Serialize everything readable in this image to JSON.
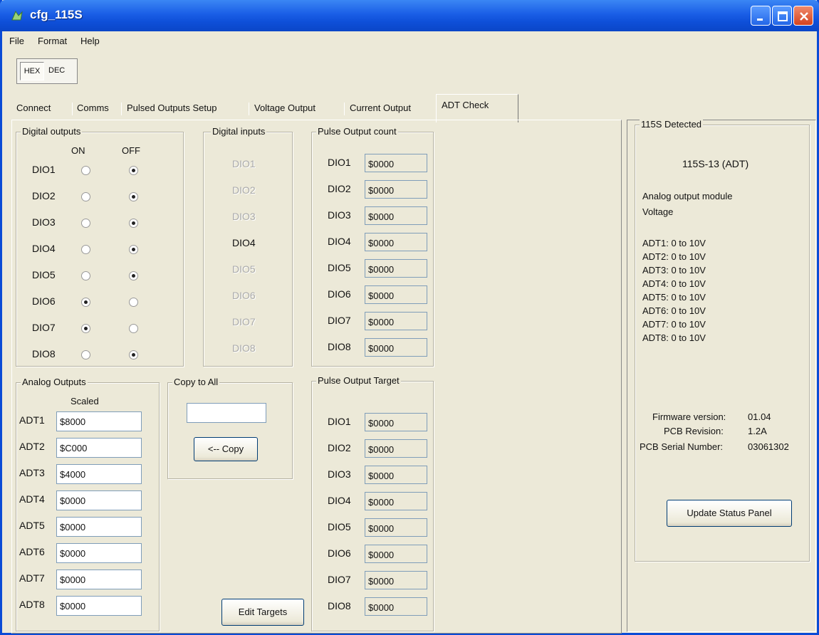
{
  "window": {
    "title": "cfg_115S"
  },
  "menu": {
    "file": "File",
    "format": "Format",
    "help": "Help"
  },
  "mode": {
    "hex": "HEX",
    "dec": "DEC"
  },
  "tabs": {
    "connect": "Connect",
    "comms": "Comms",
    "pulsed": "Pulsed Outputs Setup",
    "voltage": "Voltage Output",
    "current": "Current Output",
    "adt_check": "ADT Check"
  },
  "digital_outputs": {
    "title": "Digital outputs",
    "on_label": "ON",
    "off_label": "OFF",
    "rows": [
      {
        "label": "DIO1",
        "state": "OFF"
      },
      {
        "label": "DIO2",
        "state": "OFF"
      },
      {
        "label": "DIO3",
        "state": "OFF"
      },
      {
        "label": "DIO4",
        "state": "OFF"
      },
      {
        "label": "DIO5",
        "state": "OFF"
      },
      {
        "label": "DIO6",
        "state": "ON"
      },
      {
        "label": "DIO7",
        "state": "ON"
      },
      {
        "label": "DIO8",
        "state": "OFF"
      }
    ]
  },
  "digital_inputs": {
    "title": "Digital inputs",
    "items": [
      {
        "label": "DIO1",
        "enabled": false
      },
      {
        "label": "DIO2",
        "enabled": false
      },
      {
        "label": "DIO3",
        "enabled": false
      },
      {
        "label": "DIO4",
        "enabled": true
      },
      {
        "label": "DIO5",
        "enabled": false
      },
      {
        "label": "DIO6",
        "enabled": false
      },
      {
        "label": "DIO7",
        "enabled": false
      },
      {
        "label": "DIO8",
        "enabled": false
      }
    ]
  },
  "pulse_count": {
    "title": "Pulse Output count",
    "rows": [
      {
        "label": "DIO1",
        "value": "$0000"
      },
      {
        "label": "DIO2",
        "value": "$0000"
      },
      {
        "label": "DIO3",
        "value": "$0000"
      },
      {
        "label": "DIO4",
        "value": "$0000"
      },
      {
        "label": "DIO5",
        "value": "$0000"
      },
      {
        "label": "DIO6",
        "value": "$0000"
      },
      {
        "label": "DIO7",
        "value": "$0000"
      },
      {
        "label": "DIO8",
        "value": "$0000"
      }
    ]
  },
  "analog_outputs": {
    "title": "Analog Outputs",
    "scaled_label": "Scaled",
    "rows": [
      {
        "label": "ADT1",
        "value": "$8000"
      },
      {
        "label": "ADT2",
        "value": "$C000"
      },
      {
        "label": "ADT3",
        "value": "$4000"
      },
      {
        "label": "ADT4",
        "value": "$0000"
      },
      {
        "label": "ADT5",
        "value": "$0000"
      },
      {
        "label": "ADT6",
        "value": "$0000"
      },
      {
        "label": "ADT7",
        "value": "$0000"
      },
      {
        "label": "ADT8",
        "value": "$0000"
      }
    ]
  },
  "copy_to_all": {
    "title": "Copy to All",
    "value": "",
    "button": "<-- Copy"
  },
  "pulse_target": {
    "title": "Pulse Output Target",
    "rows": [
      {
        "label": "DIO1",
        "value": "$0000"
      },
      {
        "label": "DIO2",
        "value": "$0000"
      },
      {
        "label": "DIO3",
        "value": "$0000"
      },
      {
        "label": "DIO4",
        "value": "$0000"
      },
      {
        "label": "DIO5",
        "value": "$0000"
      },
      {
        "label": "DIO6",
        "value": "$0000"
      },
      {
        "label": "DIO7",
        "value": "$0000"
      },
      {
        "label": "DIO8",
        "value": "$0000"
      }
    ]
  },
  "edit_targets": "Edit Targets",
  "status": {
    "title": "115S Detected",
    "model": "115S-13 (ADT)",
    "module_type": "Analog output module",
    "output_kind": "Voltage",
    "ranges": [
      "ADT1: 0 to 10V",
      "ADT2: 0 to 10V",
      "ADT3: 0 to 10V",
      "ADT4: 0 to 10V",
      "ADT5: 0 to 10V",
      "ADT6: 0 to 10V",
      "ADT7: 0 to 10V",
      "ADT8: 0 to 10V"
    ],
    "firmware_label": "Firmware version:",
    "firmware_value": "01.04",
    "pcb_rev_label": "PCB Revision:",
    "pcb_rev_value": "1.2A",
    "serial_label": "PCB Serial Number:",
    "serial_value": "03061302",
    "update_button": "Update Status Panel"
  }
}
